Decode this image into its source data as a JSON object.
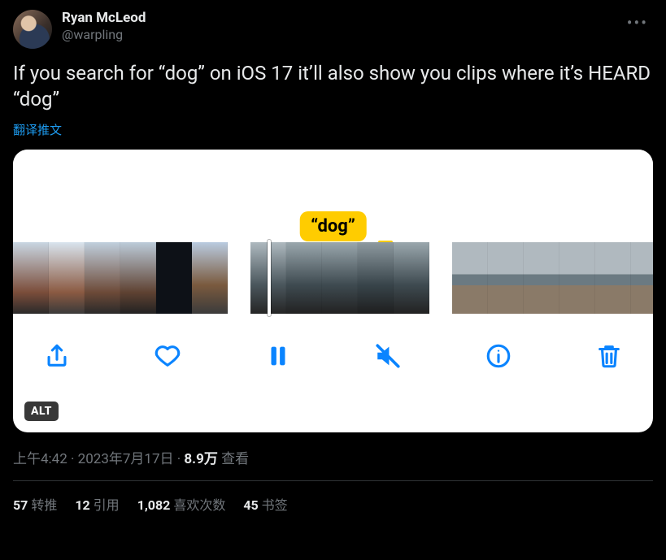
{
  "author": {
    "display_name": "Ryan McLeod",
    "handle": "@warpling"
  },
  "tweet_text": "If you search for “dog” on iOS 17 it’ll also show you clips where it’s HEARD “dog”",
  "translate_label": "翻译推文",
  "media": {
    "caption_bubble": "“dog”",
    "alt_badge": "ALT",
    "toolbar": {
      "share": "share",
      "like": "like",
      "pause": "pause",
      "mute": "mute",
      "info": "info",
      "trash": "trash"
    }
  },
  "meta": {
    "time": "上午4:42",
    "date": "2023年7月17日",
    "views_count": "8.9万",
    "views_label": "查看"
  },
  "stats": {
    "retweets_count": "57",
    "retweets_label": "转推",
    "quotes_count": "12",
    "quotes_label": "引用",
    "likes_count": "1,082",
    "likes_label": "喜欢次数",
    "bookmarks_count": "45",
    "bookmarks_label": "书签"
  }
}
